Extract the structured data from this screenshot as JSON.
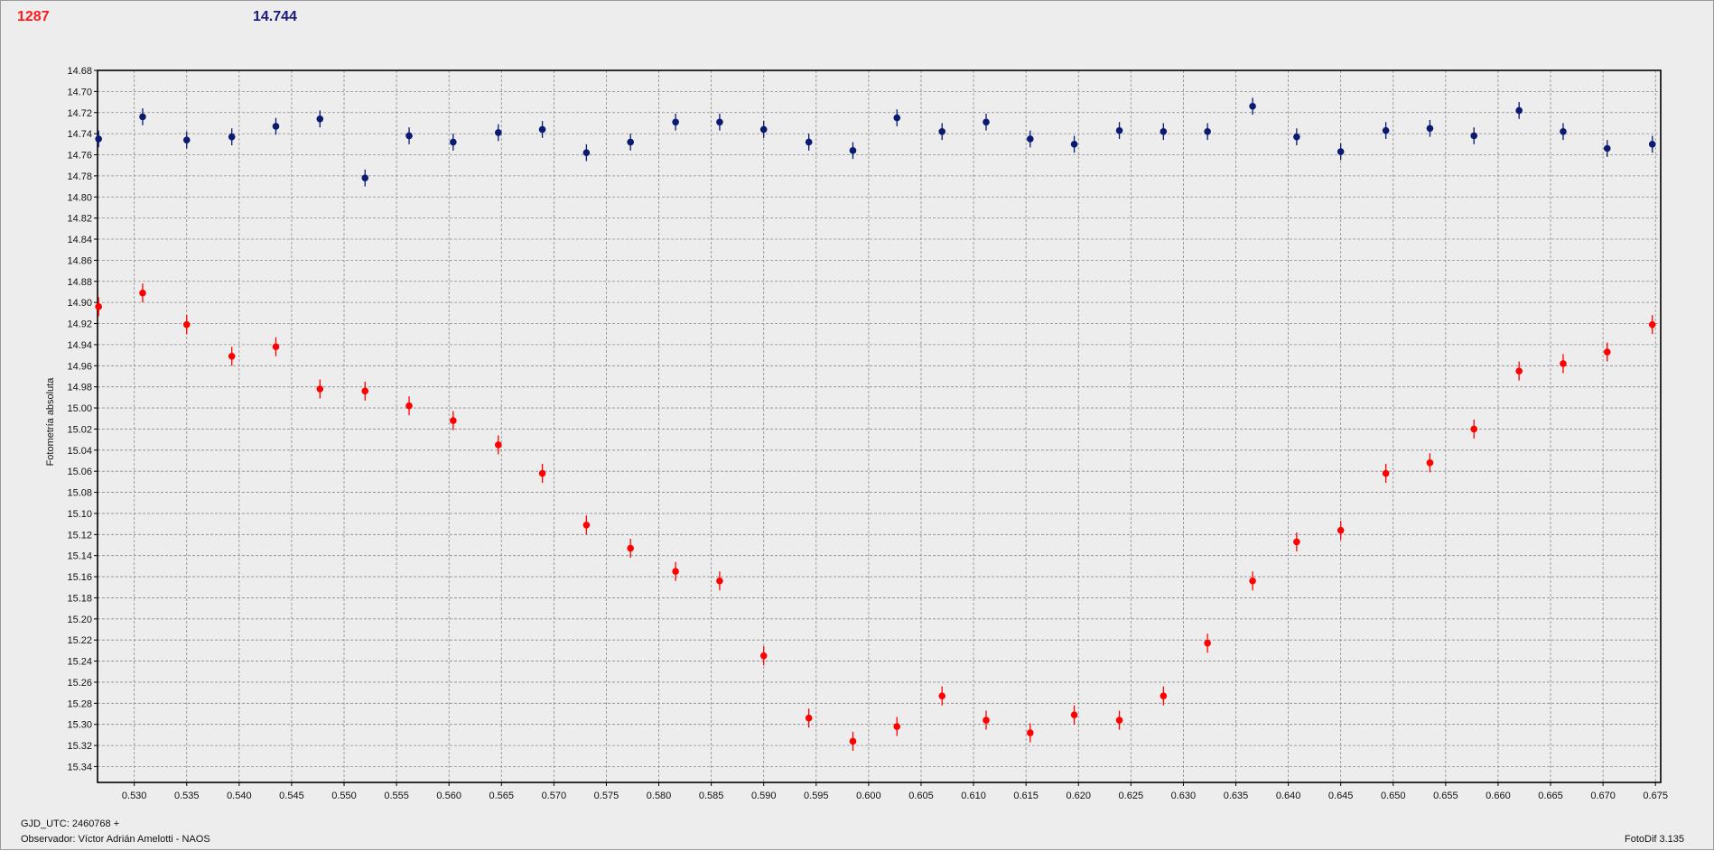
{
  "header": {
    "target_mag": "1287",
    "target_color": "#ff1a1a",
    "comp_mag": "14.744",
    "comp_color": "#1a1a7a"
  },
  "footer": {
    "gjd": "GJD_UTC: 2460768 +",
    "observer": "Observador: Víctor Adrián Amelotti - NAOS",
    "software": "FotoDif 3.135"
  },
  "chart_data": {
    "type": "scatter",
    "title": "",
    "xlabel": "",
    "ylabel": "Fotometría absoluta",
    "x_range": [
      0.5265,
      0.6755
    ],
    "y_range": [
      14.68,
      15.355
    ],
    "y_inverted": true,
    "grid": true,
    "x_ticks": [
      "0.530",
      "0.535",
      "0.540",
      "0.545",
      "0.550",
      "0.555",
      "0.560",
      "0.565",
      "0.570",
      "0.575",
      "0.580",
      "0.585",
      "0.590",
      "0.595",
      "0.600",
      "0.605",
      "0.610",
      "0.615",
      "0.620",
      "0.625",
      "0.630",
      "0.635",
      "0.640",
      "0.645",
      "0.650",
      "0.655",
      "0.660",
      "0.665",
      "0.670",
      "0.675"
    ],
    "y_ticks": [
      "14.68",
      "14.70",
      "14.72",
      "14.74",
      "14.76",
      "14.78",
      "14.80",
      "14.82",
      "14.84",
      "14.86",
      "14.88",
      "14.90",
      "14.92",
      "14.94",
      "14.96",
      "14.98",
      "15.00",
      "15.02",
      "15.04",
      "15.06",
      "15.08",
      "15.10",
      "15.12",
      "15.14",
      "15.16",
      "15.18",
      "15.20",
      "15.22",
      "15.24",
      "15.26",
      "15.28",
      "15.30",
      "15.32",
      "15.34"
    ],
    "x": [
      0.5266,
      0.5308,
      0.535,
      0.5393,
      0.5435,
      0.5477,
      0.552,
      0.5562,
      0.5604,
      0.5647,
      0.5689,
      0.5731,
      0.5773,
      0.5816,
      0.5858,
      0.59,
      0.5943,
      0.5985,
      0.6027,
      0.607,
      0.6112,
      0.6154,
      0.6196,
      0.6239,
      0.6281,
      0.6323,
      0.6366,
      0.6408,
      0.645,
      0.6493,
      0.6535,
      0.6577,
      0.662,
      0.6662,
      0.6704,
      0.6747
    ],
    "series": [
      {
        "color": "#ff0000",
        "values": [
          14.904,
          14.891,
          14.921,
          14.951,
          14.942,
          14.982,
          14.984,
          14.998,
          15.012,
          15.035,
          15.062,
          15.111,
          15.133,
          15.155,
          15.164,
          15.235,
          15.294,
          15.316,
          15.302,
          15.273,
          15.296,
          15.308,
          15.291,
          15.296,
          15.273,
          15.223,
          15.164,
          15.127,
          15.116,
          15.062,
          15.052,
          15.02,
          14.965,
          14.958,
          14.947,
          14.921
        ],
        "error": 0.006
      },
      {
        "color": "#0a1a70",
        "values": [
          14.745,
          14.724,
          14.746,
          14.743,
          14.733,
          14.726,
          14.782,
          14.742,
          14.748,
          14.739,
          14.736,
          14.758,
          14.748,
          14.729,
          14.729,
          14.736,
          14.748,
          14.756,
          14.725,
          14.738,
          14.729,
          14.745,
          14.75,
          14.737,
          14.738,
          14.738,
          14.714,
          14.743,
          14.757,
          14.737,
          14.735,
          14.742,
          14.718,
          14.738,
          14.754,
          14.75
        ],
        "error": 0.005
      }
    ]
  }
}
